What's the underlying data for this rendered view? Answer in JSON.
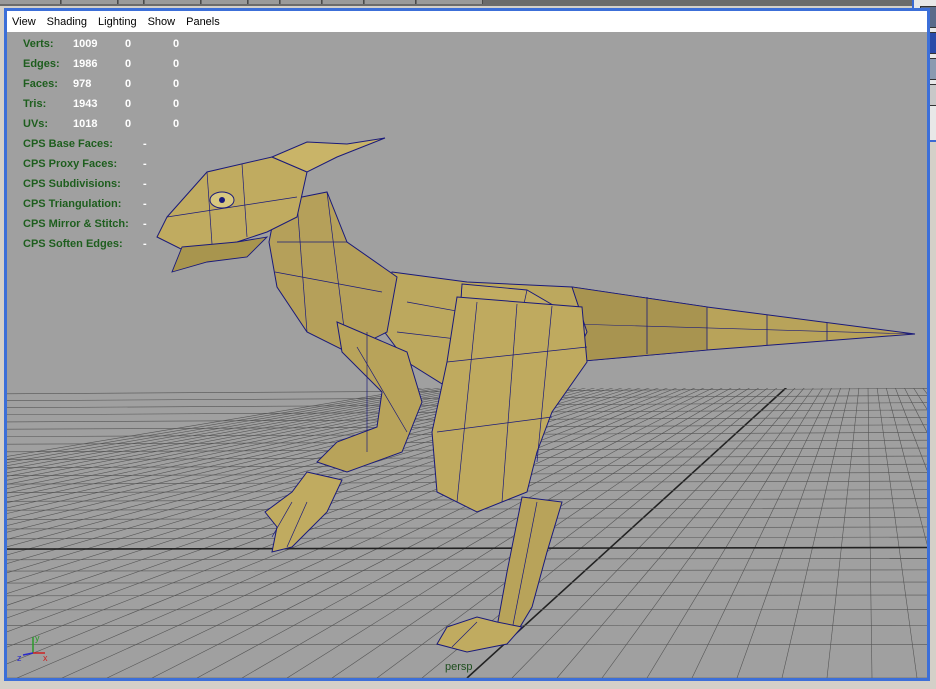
{
  "menu": {
    "items": [
      {
        "label": "View"
      },
      {
        "label": "Shading"
      },
      {
        "label": "Lighting"
      },
      {
        "label": "Show"
      },
      {
        "label": "Panels"
      }
    ]
  },
  "hud": {
    "stats": [
      {
        "label": "Verts:",
        "a": "1009",
        "b": "0",
        "c": "0"
      },
      {
        "label": "Edges:",
        "a": "1986",
        "b": "0",
        "c": "0"
      },
      {
        "label": "Faces:",
        "a": "978",
        "b": "0",
        "c": "0"
      },
      {
        "label": "Tris:",
        "a": "1943",
        "b": "0",
        "c": "0"
      },
      {
        "label": "UVs:",
        "a": "1018",
        "b": "0",
        "c": "0"
      }
    ],
    "cps": [
      {
        "label": "CPS Base Faces:",
        "value": "-"
      },
      {
        "label": "CPS Proxy Faces:",
        "value": "-"
      },
      {
        "label": "CPS Subdivisions:",
        "value": "-"
      },
      {
        "label": "CPS Triangulation:",
        "value": "-"
      },
      {
        "label": "CPS Mirror & Stitch:",
        "value": "-"
      },
      {
        "label": "CPS Soften Edges:",
        "value": "-"
      }
    ]
  },
  "viewport": {
    "camera_label": "persp",
    "background_color": "#a0a0a0",
    "grid_color": "#5a5a5a",
    "model_color": "#b8a35a",
    "wire_color": "#1a1a7a",
    "frame_color": "#3c6fd8",
    "hud_label_color": "#1e5e1e",
    "axis": {
      "x": "x",
      "y": "y",
      "z": "z"
    },
    "axis_icon": "xyz-axis-icon",
    "model": "raptor-polygon-model"
  }
}
